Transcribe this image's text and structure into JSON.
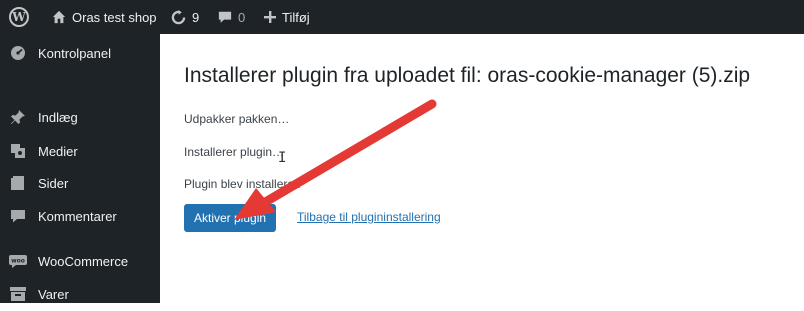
{
  "admin_bar": {
    "wp_logo_icon": "wordpress-logo-icon",
    "site_name": "Oras test shop",
    "updates_count": "9",
    "comments_count": "0",
    "new_label": "Tilføj"
  },
  "sidebar": {
    "items": [
      {
        "label": "Kontrolpanel",
        "icon": "dashboard-icon"
      },
      {
        "label": "Indlæg",
        "icon": "pin-icon"
      },
      {
        "label": "Medier",
        "icon": "media-icon"
      },
      {
        "label": "Sider",
        "icon": "pages-icon"
      },
      {
        "label": "Kommentarer",
        "icon": "comment-icon"
      },
      {
        "label": "WooCommerce",
        "icon": "woo-icon"
      },
      {
        "label": "Varer",
        "icon": "products-icon"
      }
    ]
  },
  "main": {
    "title": "Installerer plugin fra uploadet fil: oras-cookie-manager (5).zip",
    "status_lines": [
      "Udpakker pakken…",
      "Installerer plugin…",
      "Plugin blev installeret."
    ],
    "activate_button": "Aktiver plugin",
    "back_link": "Tilbage til plugininstallering"
  },
  "colors": {
    "admin_dark": "#1d2327",
    "primary_blue": "#2271b1",
    "annotation_red": "#e53935"
  }
}
